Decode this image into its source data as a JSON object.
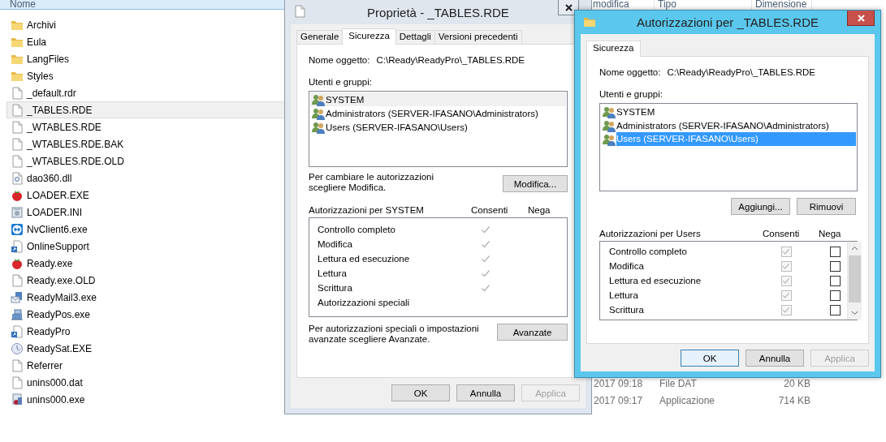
{
  "explorer": {
    "columns": [
      {
        "label": "Nome",
        "sorted": true
      },
      {
        "label": "modifica",
        "sorted": false
      },
      {
        "label": "Tipo",
        "sorted": false
      },
      {
        "label": "Dimensione",
        "sorted": false
      }
    ],
    "files": [
      {
        "name": "Archivi",
        "kind": "folder",
        "selected": false
      },
      {
        "name": "Eula",
        "kind": "folder",
        "selected": false
      },
      {
        "name": "LangFiles",
        "kind": "folder",
        "selected": false
      },
      {
        "name": "Styles",
        "kind": "folder",
        "selected": false
      },
      {
        "name": "_default.rdr",
        "kind": "file",
        "selected": false
      },
      {
        "name": "_TABLES.RDE",
        "kind": "file",
        "selected": true
      },
      {
        "name": "_WTABLES.RDE",
        "kind": "file",
        "selected": false
      },
      {
        "name": "_WTABLES.RDE.BAK",
        "kind": "file",
        "selected": false
      },
      {
        "name": "_WTABLES.RDE.OLD",
        "kind": "file",
        "selected": false
      },
      {
        "name": "dao360.dll",
        "kind": "dll",
        "selected": false
      },
      {
        "name": "LOADER.EXE",
        "kind": "strawberry",
        "selected": false
      },
      {
        "name": "LOADER.INI",
        "kind": "settings",
        "selected": false
      },
      {
        "name": "NvClient6.exe",
        "kind": "remote",
        "selected": false
      },
      {
        "name": "OnlineSupport",
        "kind": "shortcut",
        "selected": false
      },
      {
        "name": "Ready.exe",
        "kind": "strawberry",
        "selected": false
      },
      {
        "name": "Ready.exe.OLD",
        "kind": "file",
        "selected": false
      },
      {
        "name": "ReadyMail3.exe",
        "kind": "mail",
        "selected": false
      },
      {
        "name": "ReadyPos.exe",
        "kind": "register",
        "selected": false
      },
      {
        "name": "ReadyPro",
        "kind": "shortcut",
        "selected": false
      },
      {
        "name": "ReadySat.EXE",
        "kind": "disc",
        "selected": false
      },
      {
        "name": "Referrer",
        "kind": "file",
        "selected": false
      },
      {
        "name": "unins000.dat",
        "kind": "file",
        "selected": false,
        "modified": "2017 09:18",
        "type": "File DAT",
        "size": "20 KB"
      },
      {
        "name": "unins000.exe",
        "kind": "setup",
        "selected": false,
        "modified": "2017 09:17",
        "type": "Applicazione",
        "size": "714 KB"
      }
    ]
  },
  "properties_dialog": {
    "title": "Proprietà - _TABLES.RDE",
    "active": false,
    "tabs": [
      {
        "label": "Generale",
        "selected": false
      },
      {
        "label": "Sicurezza",
        "selected": true
      },
      {
        "label": "Dettagli",
        "selected": false
      },
      {
        "label": "Versioni precedenti",
        "selected": false
      }
    ],
    "object_label": "Nome oggetto:",
    "object_path": "C:\\Ready\\ReadyPro\\_TABLES.RDE",
    "users_label": "Utenti e gruppi:",
    "users": [
      {
        "name": "SYSTEM",
        "selected": true
      },
      {
        "name": "Administrators (SERVER-IFASANO\\Administrators)",
        "selected": false
      },
      {
        "name": "Users (SERVER-IFASANO\\Users)",
        "selected": false
      }
    ],
    "change_hint": "Per cambiare le autorizzazioni scegliere Modifica.",
    "edit_button": "Modifica...",
    "permissions_label": "Autorizzazioni per SYSTEM",
    "allow_header": "Consenti",
    "deny_header": "Nega",
    "permissions": [
      {
        "name": "Controllo completo",
        "allow": true
      },
      {
        "name": "Modifica",
        "allow": true
      },
      {
        "name": "Lettura ed esecuzione",
        "allow": true
      },
      {
        "name": "Lettura",
        "allow": true
      },
      {
        "name": "Scrittura",
        "allow": true
      },
      {
        "name": "Autorizzazioni speciali",
        "allow": false
      }
    ],
    "advanced_hint": "Per autorizzazioni speciali o impostazioni avanzate scegliere Avanzate.",
    "advanced_button": "Avanzate",
    "buttons": [
      {
        "label": "OK",
        "disabled": false,
        "default": false
      },
      {
        "label": "Annulla",
        "disabled": false,
        "default": false
      },
      {
        "label": "Applica",
        "disabled": true,
        "default": false
      }
    ]
  },
  "permissions_dialog": {
    "title": "Autorizzazioni per _TABLES.RDE",
    "active": true,
    "tabs": [
      {
        "label": "Sicurezza",
        "selected": true
      }
    ],
    "object_label": "Nome oggetto:",
    "object_path": "C:\\Ready\\ReadyPro\\_TABLES.RDE",
    "users_label": "Utenti e gruppi:",
    "users": [
      {
        "name": "SYSTEM",
        "selected": false
      },
      {
        "name": "Administrators (SERVER-IFASANO\\Administrators)",
        "selected": false
      },
      {
        "name": "Users (SERVER-IFASANO\\Users)",
        "selected": true
      }
    ],
    "add_button": "Aggiungi...",
    "remove_button": "Rimuovi",
    "permissions_label": "Autorizzazioni per Users",
    "allow_header": "Consenti",
    "deny_header": "Nega",
    "permissions": [
      {
        "name": "Controllo completo",
        "allow": true,
        "allow_disabled": true,
        "deny": false
      },
      {
        "name": "Modifica",
        "allow": true,
        "allow_disabled": true,
        "deny": false
      },
      {
        "name": "Lettura ed esecuzione",
        "allow": true,
        "allow_disabled": true,
        "deny": false
      },
      {
        "name": "Lettura",
        "allow": true,
        "allow_disabled": true,
        "deny": false
      },
      {
        "name": "Scrittura",
        "allow": true,
        "allow_disabled": true,
        "deny": false
      }
    ],
    "buttons": [
      {
        "label": "OK",
        "disabled": false,
        "default": true
      },
      {
        "label": "Annulla",
        "disabled": false,
        "default": false
      },
      {
        "label": "Applica",
        "disabled": true,
        "default": false
      }
    ]
  }
}
